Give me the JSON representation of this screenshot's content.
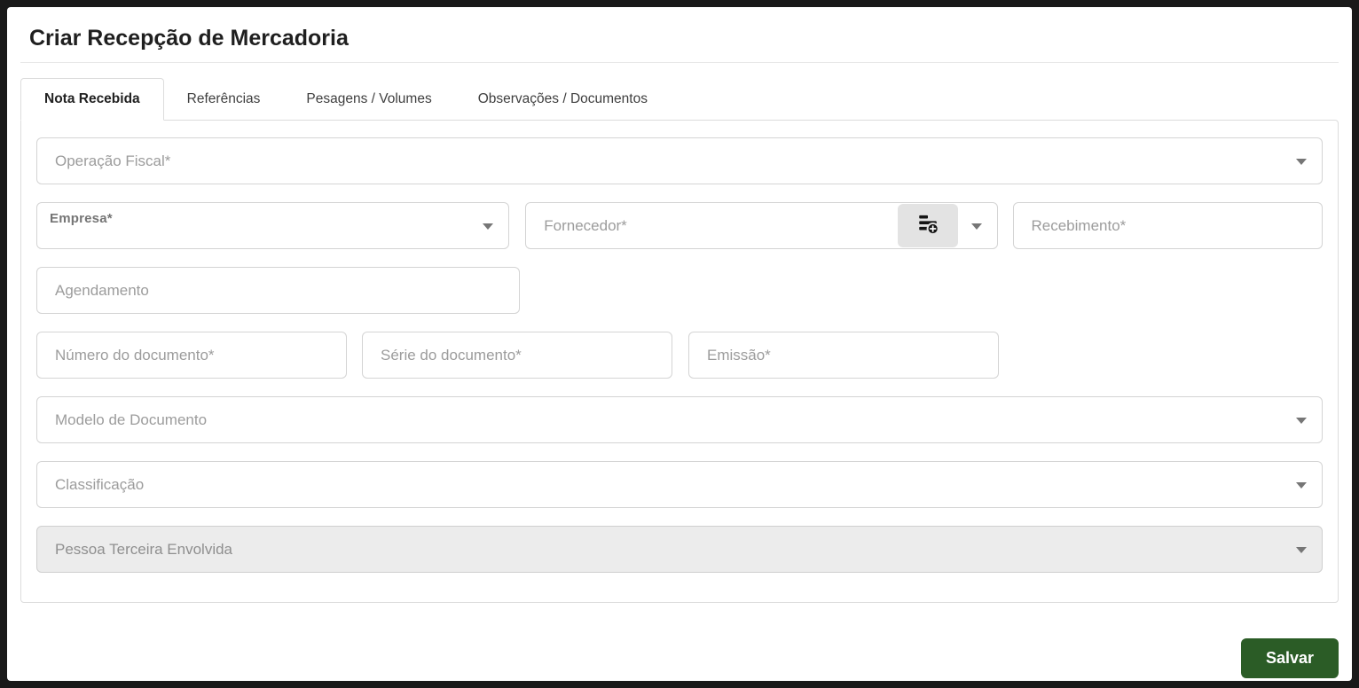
{
  "page": {
    "title": "Criar Recepção de Mercadoria"
  },
  "tabs": [
    {
      "label": "Nota Recebida",
      "active": true
    },
    {
      "label": "Referências",
      "active": false
    },
    {
      "label": "Pesagens / Volumes",
      "active": false
    },
    {
      "label": "Observações / Documentos",
      "active": false
    }
  ],
  "form": {
    "operacao_fiscal": {
      "placeholder": "Operação Fiscal*",
      "type": "dropdown"
    },
    "empresa": {
      "label": "Empresa*",
      "type": "dropdown"
    },
    "fornecedor": {
      "placeholder": "Fornecedor*",
      "type": "combobox-with-add",
      "add_icon": "list-add-icon"
    },
    "recebimento": {
      "placeholder": "Recebimento*",
      "type": "input"
    },
    "agendamento": {
      "placeholder": "Agendamento",
      "type": "input"
    },
    "numero_documento": {
      "placeholder": "Número do documento*",
      "type": "input"
    },
    "serie_documento": {
      "placeholder": "Série do documento*",
      "type": "input"
    },
    "emissao": {
      "placeholder": "Emissão*",
      "type": "input"
    },
    "modelo_documento": {
      "placeholder": "Modelo de Documento",
      "type": "dropdown"
    },
    "classificacao": {
      "placeholder": "Classificação",
      "type": "dropdown"
    },
    "pessoa_terceira": {
      "placeholder": "Pessoa Terceira Envolvida",
      "type": "dropdown",
      "disabled": true
    }
  },
  "actions": {
    "save_label": "Salvar"
  },
  "colors": {
    "accent_green": "#2b5c26",
    "frame_dark": "#191919",
    "border_light": "#dcdcdc",
    "placeholder_gray": "#9c9c9c",
    "disabled_bg": "#ececec",
    "icon_button_bg": "#e3e3e3"
  }
}
